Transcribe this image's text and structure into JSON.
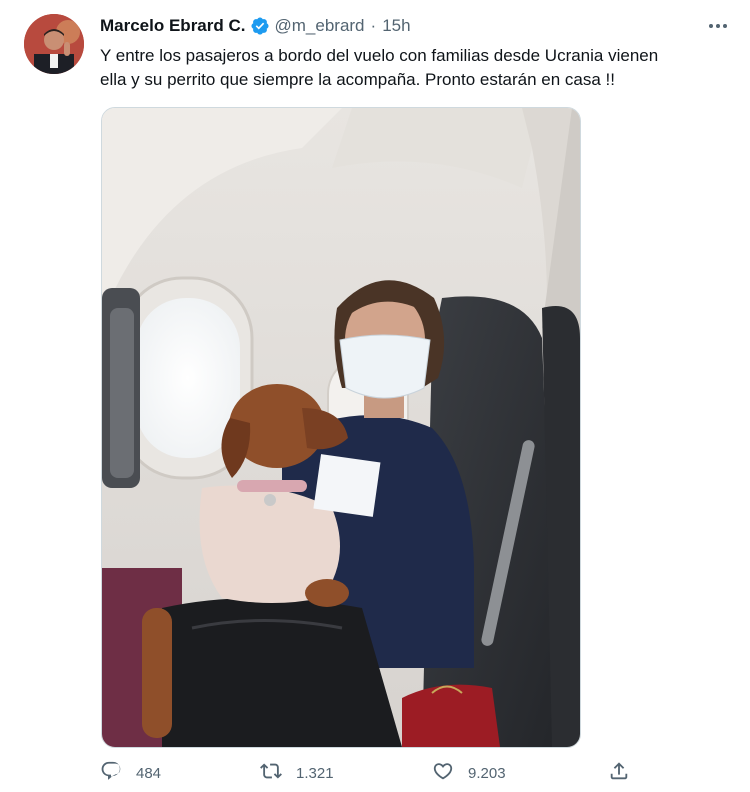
{
  "tweet": {
    "author": {
      "name": "Marcelo Ebrard C.",
      "handle": "@m_ebrard",
      "verified": true
    },
    "separator": "·",
    "time": "15h",
    "text_lines": [
      "Y  entre los pasajeros a bordo del vuelo con familias desde Ucrania vienen",
      "ella y su perrito que siempre la acompaña. Pronto estarán en casa !!"
    ],
    "stats": {
      "replies": "484",
      "retweets": "1.321",
      "likes": "9.203"
    },
    "icons": {
      "reply": "reply-icon",
      "retweet": "retweet-icon",
      "like": "heart-icon",
      "share": "share-icon",
      "more": "more-icon",
      "verified": "verified-badge-icon"
    },
    "colors": {
      "verified": "#1d9bf0",
      "secondary_text": "#536471",
      "text": "#0f1419"
    }
  }
}
